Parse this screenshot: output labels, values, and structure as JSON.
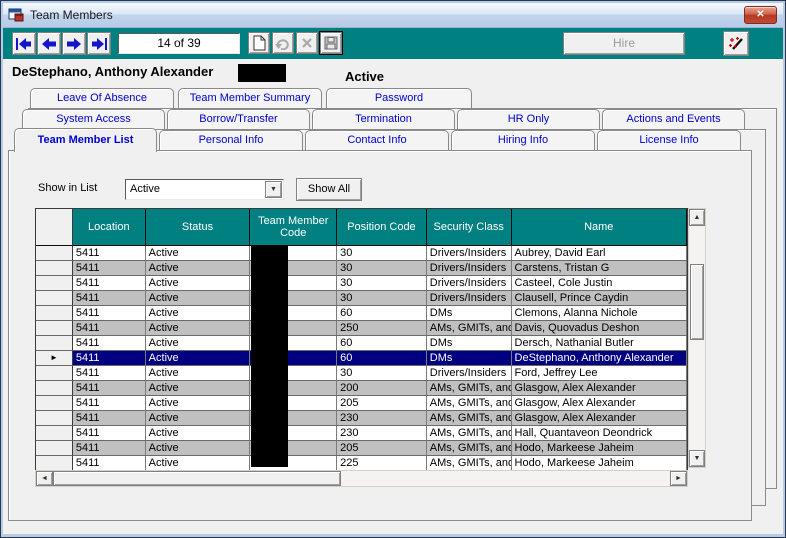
{
  "window": {
    "title": "Team Members"
  },
  "icons": {
    "close": "✕",
    "dropdown_arrow": "▼",
    "scroll_up": "▲",
    "scroll_down": "▼",
    "scroll_left": "◄",
    "scroll_right": "►",
    "row_pointer": "►"
  },
  "toolbar": {
    "counter": "14 of 39",
    "hire_label": "Hire"
  },
  "record_header": {
    "name": "DeStephano, Anthony Alexander",
    "status": "Active"
  },
  "tabs": {
    "row1": [
      "Leave Of Absence",
      "Team Member Summary",
      "Password"
    ],
    "row2": [
      "System Access",
      "Borrow/Transfer",
      "Termination",
      "HR Only",
      "Actions and Events"
    ],
    "row3": [
      "Team Member List",
      "Personal Info",
      "Contact Info",
      "Hiring Info",
      "License Info"
    ],
    "active_tab": "Team Member List"
  },
  "filter": {
    "label": "Show in List",
    "value": "Active",
    "show_all_label": "Show All"
  },
  "grid": {
    "columns": [
      "Location",
      "Status",
      "Team Member Code",
      "Position Code",
      "Security Class",
      "Name"
    ],
    "redacted_columns": [
      "Team Member Code"
    ],
    "rows": [
      {
        "location": "5411",
        "status": "Active",
        "team_member_code": "",
        "position_code": "30",
        "security_class": "Drivers/Insiders",
        "name": "Aubrey, David Earl",
        "selected": false
      },
      {
        "location": "5411",
        "status": "Active",
        "team_member_code": "",
        "position_code": "30",
        "security_class": "Drivers/Insiders",
        "name": "Carstens, Tristan G",
        "selected": false
      },
      {
        "location": "5411",
        "status": "Active",
        "team_member_code": "",
        "position_code": "30",
        "security_class": "Drivers/Insiders",
        "name": "Casteel, Cole Justin",
        "selected": false
      },
      {
        "location": "5411",
        "status": "Active",
        "team_member_code": "",
        "position_code": "30",
        "security_class": "Drivers/Insiders",
        "name": "Clausell, Prince Caydin",
        "selected": false
      },
      {
        "location": "5411",
        "status": "Active",
        "team_member_code": "",
        "position_code": "60",
        "security_class": "DMs",
        "name": "Clemons, Alanna Nichole",
        "selected": false
      },
      {
        "location": "5411",
        "status": "Active",
        "team_member_code": "",
        "position_code": "250",
        "security_class": "AMs, GMITs, and S",
        "name": "Davis, Quovadus Deshon",
        "selected": false
      },
      {
        "location": "5411",
        "status": "Active",
        "team_member_code": "",
        "position_code": "60",
        "security_class": "DMs",
        "name": "Dersch, Nathanial Butler",
        "selected": false
      },
      {
        "location": "5411",
        "status": "Active",
        "team_member_code": "",
        "position_code": "60",
        "security_class": "DMs",
        "name": "DeStephano, Anthony Alexander",
        "selected": true
      },
      {
        "location": "5411",
        "status": "Active",
        "team_member_code": "",
        "position_code": "30",
        "security_class": "Drivers/Insiders",
        "name": "Ford, Jeffrey Lee",
        "selected": false
      },
      {
        "location": "5411",
        "status": "Active",
        "team_member_code": "",
        "position_code": "200",
        "security_class": "AMs, GMITs, and S",
        "name": "Glasgow, Alex Alexander",
        "selected": false
      },
      {
        "location": "5411",
        "status": "Active",
        "team_member_code": "",
        "position_code": "205",
        "security_class": "AMs, GMITs, and S",
        "name": "Glasgow, Alex Alexander",
        "selected": false
      },
      {
        "location": "5411",
        "status": "Active",
        "team_member_code": "",
        "position_code": "230",
        "security_class": "AMs, GMITs, and S",
        "name": "Glasgow, Alex Alexander",
        "selected": false
      },
      {
        "location": "5411",
        "status": "Active",
        "team_member_code": "",
        "position_code": "230",
        "security_class": "AMs, GMITs, and S",
        "name": "Hall, Quantaveon Deondrick",
        "selected": false
      },
      {
        "location": "5411",
        "status": "Active",
        "team_member_code": "",
        "position_code": "205",
        "security_class": "AMs, GMITs, and S",
        "name": "Hodo, Markeese Jaheim",
        "selected": false
      },
      {
        "location": "5411",
        "status": "Active",
        "team_member_code": "",
        "position_code": "225",
        "security_class": "AMs, GMITs, and S",
        "name": "Hodo, Markeese Jaheim",
        "selected": false
      }
    ]
  },
  "colors": {
    "toolbar_teal": "#008080",
    "grid_header_teal": "#008080",
    "selected_row_navy": "#000080",
    "alt_row_gray": "#C0C0C0",
    "tab_text_blue": "#0000CC",
    "close_button_red": "#C1472E"
  }
}
